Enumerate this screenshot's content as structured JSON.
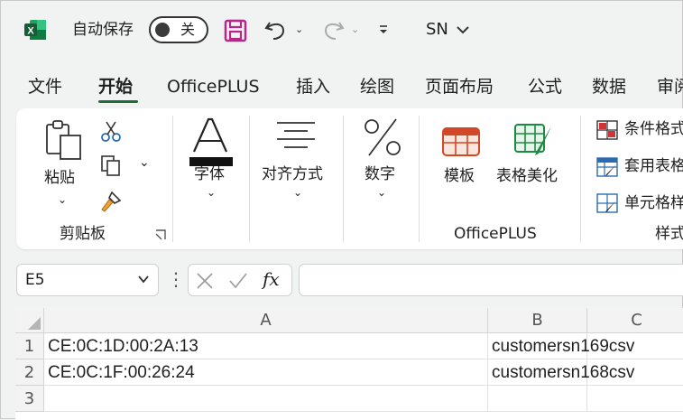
{
  "titlebar": {
    "autosave_label": "自动保存",
    "toggle_text": "关",
    "profile": "SN"
  },
  "tabs": [
    "文件",
    "开始",
    "OfficePLUS",
    "插入",
    "绘图",
    "页面布局",
    "公式",
    "数据",
    "审阅"
  ],
  "active_tab": "开始",
  "ribbon": {
    "clipboard": {
      "paste": "粘贴",
      "group_label": "剪贴板"
    },
    "font": {
      "label": "字体"
    },
    "alignment": {
      "label": "对齐方式"
    },
    "number": {
      "label": "数字"
    },
    "officeplus": {
      "template": "模板",
      "beautify": "表格美化",
      "group_label": "OfficePLUS"
    },
    "styles": {
      "conditional": "条件格式",
      "table_format": "套用表格格式",
      "cell_styles": "单元格样式",
      "group_label": "样式"
    }
  },
  "formula_bar": {
    "name_box": "E5",
    "fx": "fx",
    "formula": ""
  },
  "sheet": {
    "columns": [
      "A",
      "B",
      "C"
    ],
    "rows": [
      {
        "num": "1",
        "a": "CE:0C:1D:00:2A:13",
        "b": "customersn169csv",
        "c": ""
      },
      {
        "num": "2",
        "a": "CE:0C:1F:00:26:24",
        "b": "customersn168csv",
        "c": ""
      },
      {
        "num": "3",
        "a": "",
        "b": "",
        "c": ""
      }
    ]
  },
  "colors": {
    "excel_green": "#1e6e3a",
    "save_purple": "#b4278b",
    "office_orange": "#d24726"
  }
}
